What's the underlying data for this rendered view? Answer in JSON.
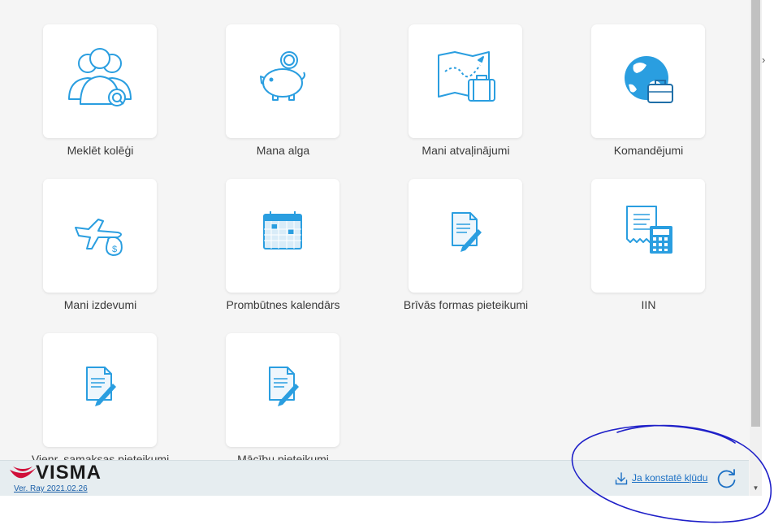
{
  "tiles": [
    {
      "label": "Meklēt kolēģi",
      "icon": "people-search-icon"
    },
    {
      "label": "Mana alga",
      "icon": "piggy-bank-icon"
    },
    {
      "label": "Mani atvaļinājumi",
      "icon": "map-suitcase-icon"
    },
    {
      "label": "Komandējumi",
      "icon": "globe-briefcase-icon"
    },
    {
      "label": "Mani izdevumi",
      "icon": "plane-moneybag-icon"
    },
    {
      "label": "Prombūtnes kalendārs",
      "icon": "calendar-icon"
    },
    {
      "label": "Brīvās formas pieteikumi",
      "icon": "document-pen-icon"
    },
    {
      "label": "IIN",
      "icon": "receipt-calculator-icon"
    },
    {
      "label": "Vienr. samaksas pieteikumi",
      "icon": "document-pen-icon"
    },
    {
      "label": "Mācību pieteikumi",
      "icon": "document-pen-icon"
    }
  ],
  "footer": {
    "logo": "VISMA",
    "version": "Ver. Ray 2021.02.26",
    "report_link": "Ja konstatē kļūdu"
  },
  "colors": {
    "icon_blue": "#2a9ee0",
    "logo_red": "#d0103a",
    "link_blue": "#1a6fc4",
    "annotation_ink": "#1f20c8"
  }
}
